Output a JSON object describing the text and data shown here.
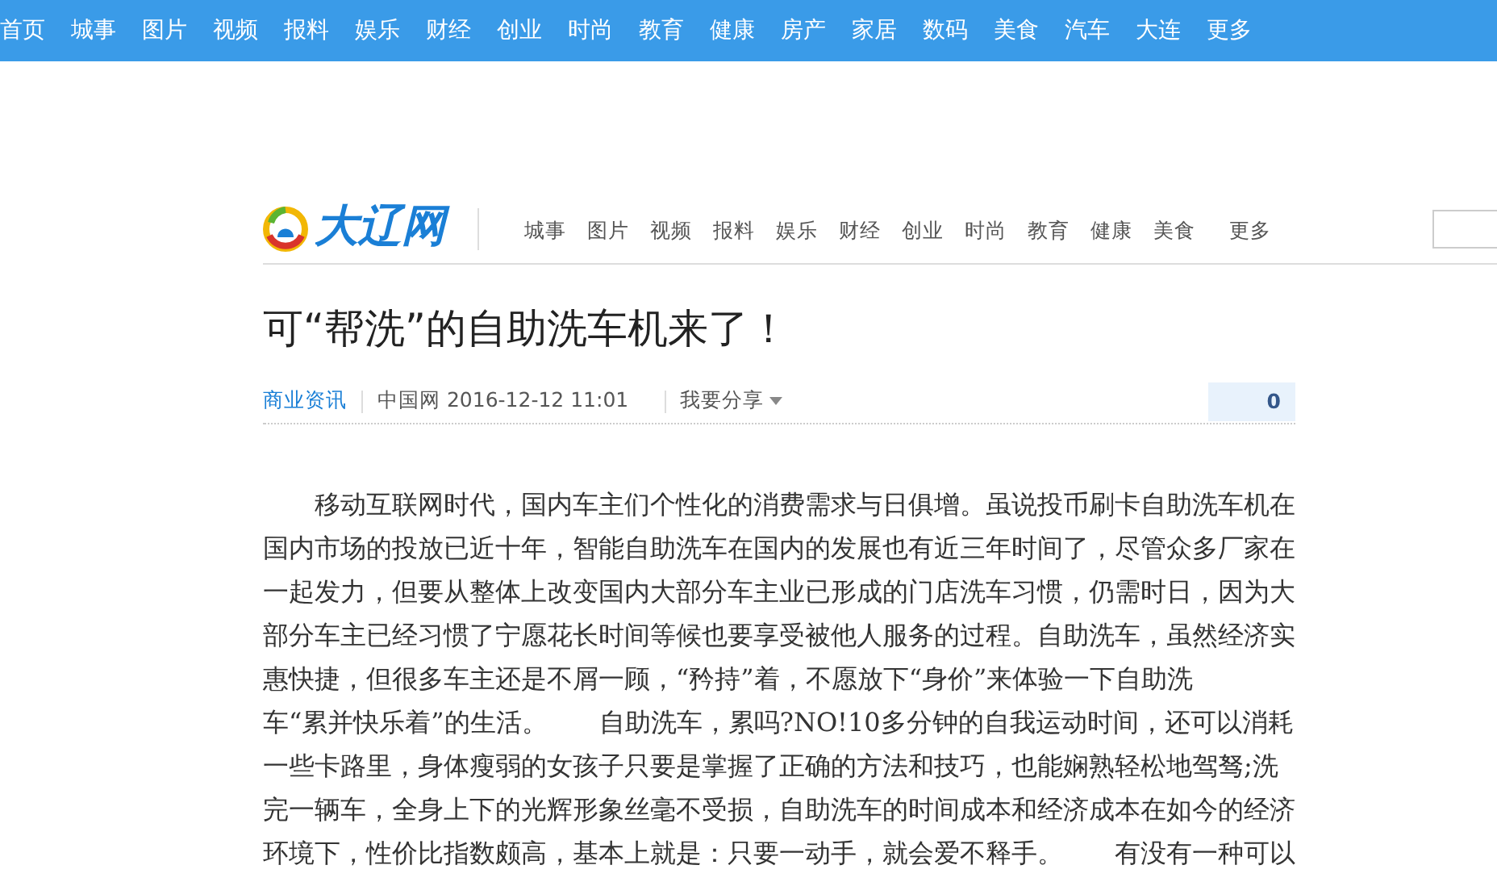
{
  "top_nav": [
    "首页",
    "城事",
    "图片",
    "视频",
    "报料",
    "娱乐",
    "财经",
    "创业",
    "时尚",
    "教育",
    "健康",
    "房产",
    "家居",
    "数码",
    "美食",
    "汽车",
    "大连",
    "更多"
  ],
  "logo": {
    "text": "大辽网"
  },
  "site_nav": [
    "城事",
    "图片",
    "视频",
    "报料",
    "娱乐",
    "财经",
    "创业",
    "时尚",
    "教育",
    "健康",
    "美食",
    "更多"
  ],
  "article": {
    "title": "可“帮洗”的自助洗车机来了！",
    "category": "商业资讯",
    "source": "中国网 2016-12-12 11:01",
    "share": "我要分享",
    "comment_count": "0",
    "lines": [
      "移动互联网时代，国内车主们个性化的消费需求与日俱增。虽说投币刷卡自助洗车机在",
      "国内市场的投放已近十年，智能自助洗车在国内的发展也有近三年时间了，尽管众多厂家在",
      "一起发力，但要从整体上改变国内大部分车主业已形成的门店洗车习惯，仍需时日，因为大",
      "部分车主已经习惯了宁愿花长时间等候也要享受被他人服务的过程。自助洗车，虽然经济实",
      "惠快捷，但很多车主还是不屑一顾，“矜持”着，不愿放下“身价”来体验一下自助洗",
      "车“累并快乐着”的生活。　　自助洗车，累吗?NO!10多分钟的自我运动时间，还可以消耗",
      "一些卡路里，身体瘦弱的女孩子只要是掌握了正确的方法和技巧，也能娴熟轻松地驾驽;洗",
      "完一辆车，全身上下的光辉形象丝毫不受损，自助洗车的时间成本和经济成本在如今的经济",
      "环境下，性价比指数颇高，基本上就是：只要一动手，就会爱不释手。　　有没有一种可以"
    ]
  }
}
